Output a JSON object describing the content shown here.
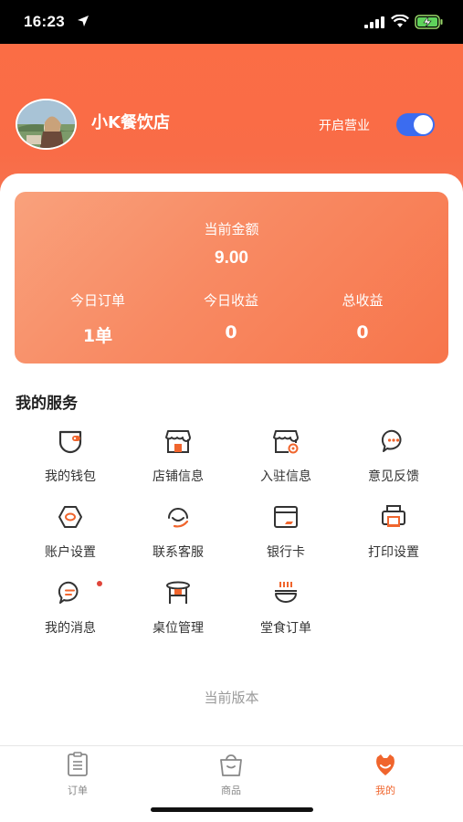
{
  "status_bar": {
    "time": "16:23"
  },
  "header": {
    "shop_name": "小K餐饮店",
    "open_label": "开启营业",
    "open_toggle_on": true,
    "accent_color": "#fb6d45"
  },
  "stats": {
    "balance_label": "当前金额",
    "balance_value": "9.00",
    "items": [
      {
        "label": "今日订单",
        "value": "1单"
      },
      {
        "label": "今日收益",
        "value": "0"
      },
      {
        "label": "总收益",
        "value": "0"
      }
    ]
  },
  "services": {
    "title": "我的服务",
    "items": [
      {
        "label": "我的钱包",
        "icon": "wallet-icon"
      },
      {
        "label": "店铺信息",
        "icon": "shop-icon"
      },
      {
        "label": "入驻信息",
        "icon": "shop-settings-icon"
      },
      {
        "label": "意见反馈",
        "icon": "feedback-chat-icon"
      },
      {
        "label": "账户设置",
        "icon": "account-settings-icon"
      },
      {
        "label": "联系客服",
        "icon": "customer-service-icon"
      },
      {
        "label": "银行卡",
        "icon": "bank-card-icon"
      },
      {
        "label": "打印设置",
        "icon": "printer-icon"
      },
      {
        "label": "我的消息",
        "icon": "message-icon"
      },
      {
        "label": "桌位管理",
        "icon": "table-icon"
      },
      {
        "label": "堂食订单",
        "icon": "dine-in-bowl-icon"
      }
    ]
  },
  "version_label": "当前版本",
  "tabbar": {
    "items": [
      {
        "label": "订单",
        "icon": "order-clipboard-icon",
        "active": false
      },
      {
        "label": "商品",
        "icon": "goods-bag-icon",
        "active": false
      },
      {
        "label": "我的",
        "icon": "profile-icon",
        "active": true
      }
    ]
  }
}
